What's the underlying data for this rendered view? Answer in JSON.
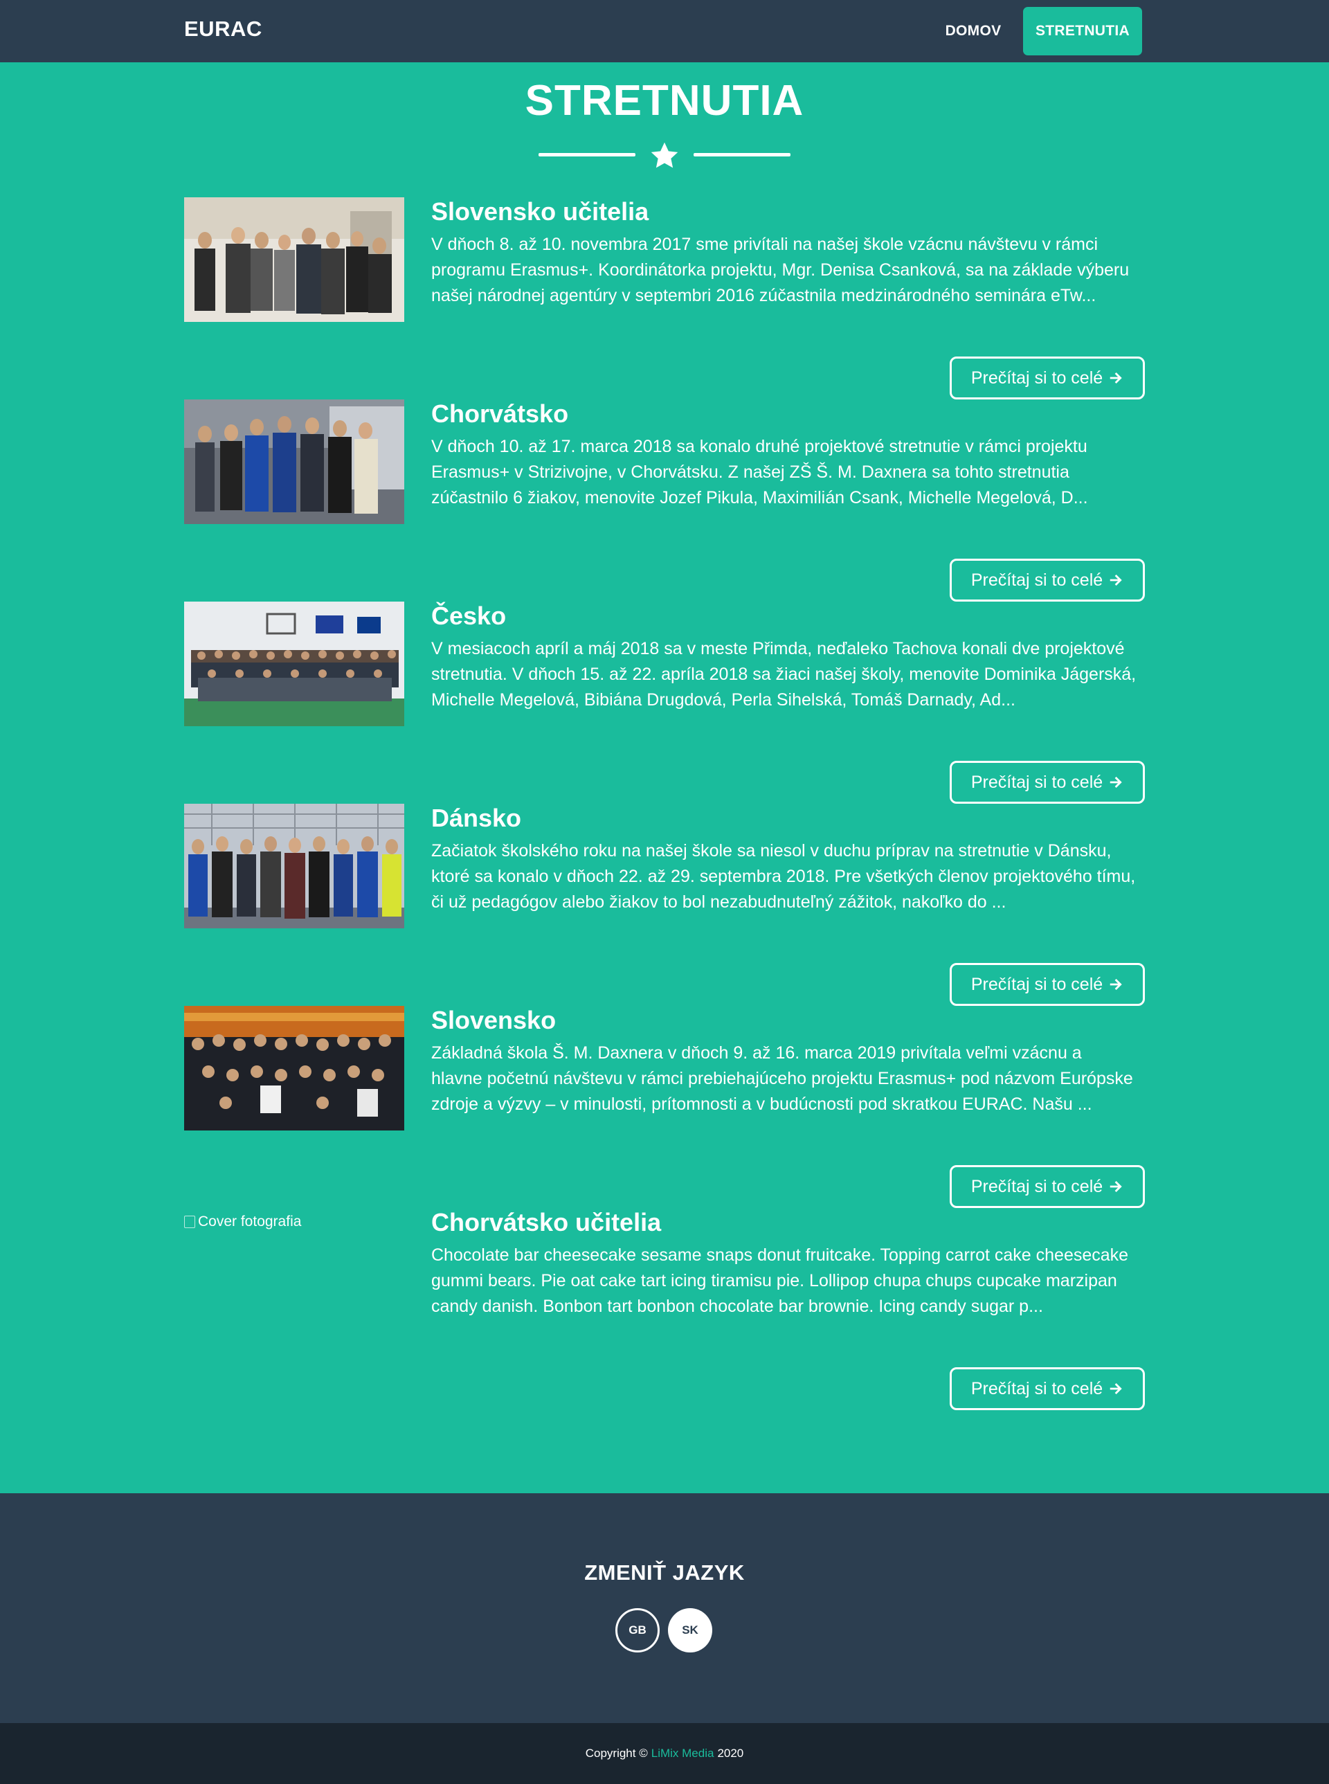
{
  "navbar": {
    "brand": "EURAC",
    "items": [
      {
        "label": "DOMOV"
      },
      {
        "label": "STRETNUTIA"
      }
    ]
  },
  "header": {
    "title": "STRETNUTIA",
    "divider_icon": "star-icon"
  },
  "articles": [
    {
      "title": "Slovensko učitelia",
      "text": "V dňoch 8. až 10. novembra 2017 sme privítali na našej škole vzácnu návštevu v rámci programu Erasmus+. Koordinátorka projektu, Mgr. Denisa Csanková, sa na základe výberu našej národnej agentúry v septembri 2016 zúčastnila medzinárodného seminára eTw...",
      "button": "Prečítaj si to celé",
      "button_icon": "arrow-right-icon",
      "image": "photo"
    },
    {
      "title": "Chorvátsko",
      "text": "V dňoch 10. až 17. marca 2018 sa konalo druhé projektové stretnutie v rámci projektu Erasmus+ v Strizivojne, v Chorvátsku. Z našej ZŠ Š. M. Daxnera sa tohto stretnutia zúčastnilo 6 žiakov, menovite Jozef Pikula, Maximilián Csank, Michelle Megelová, D...",
      "button": "Prečítaj si to celé",
      "button_icon": "arrow-right-icon",
      "image": "photo"
    },
    {
      "title": "Česko",
      "text": "V mesiacoch apríl a máj 2018 sa v meste Přimda, neďaleko Tachova konali dve projektové stretnutia. V dňoch 15. až 22. apríla 2018 sa žiaci našej školy, menovite Dominika Jágerská, Michelle Megelová, Bibiána Drugdová, Perla Sihelská, Tomáš Darnady, Ad...",
      "button": "Prečítaj si to celé",
      "button_icon": "arrow-right-icon",
      "image": "photo"
    },
    {
      "title": "Dánsko",
      "text": "Začiatok školského roku na našej škole sa niesol v duchu príprav na stretnutie v Dánsku, ktoré sa konalo v dňoch 22. až 29. septembra 2018. Pre všetkých členov projektového tímu, či už pedagógov alebo žiakov to bol nezabudnuteľný zážitok, nakoľko do ...",
      "button": "Prečítaj si to celé",
      "button_icon": "arrow-right-icon",
      "image": "photo"
    },
    {
      "title": "Slovensko",
      "text": "Základná škola Š. M. Daxnera v dňoch 9. až 16. marca 2019 privítala veľmi vzácnu a hlavne početnú návštevu v rámci prebiehajúceho projektu Erasmus+ pod názvom Európske zdroje a výzvy – v minulosti, prítomnosti a v budúcnosti pod skratkou EURAC. Našu ...",
      "button": "Prečítaj si to celé",
      "button_icon": "arrow-right-icon",
      "image": "photo"
    },
    {
      "title": "Chorvátsko učitelia",
      "text": "Chocolate bar cheesecake sesame snaps donut fruitcake. Topping carrot cake cheesecake gummi bears. Pie oat cake tart icing tiramisu pie. Lollipop chupa chups cupcake marzipan candy danish. Bonbon tart bonbon chocolate bar brownie. Icing candy sugar p...",
      "button": "Prečítaj si to celé",
      "button_icon": "arrow-right-icon",
      "image": "broken",
      "image_alt": "Cover fotografia"
    }
  ],
  "footer": {
    "title": "ZMENIŤ JAZYK",
    "languages": [
      {
        "label": "GB"
      },
      {
        "label": "SK"
      }
    ]
  },
  "copyright": {
    "prefix": "Copyright ©",
    "brand": "LiMix Media",
    "year": "2020"
  },
  "colors": {
    "primary": "#1abc9c",
    "navbar": "#2c3e50",
    "copyright_bar": "#1a252f",
    "text": "#ffffff"
  }
}
